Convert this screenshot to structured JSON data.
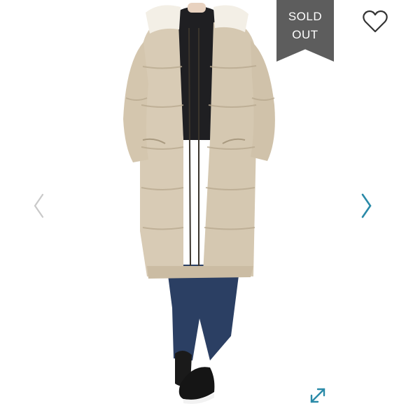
{
  "badge": {
    "line1": "SOLD",
    "line2": "OUT",
    "color": "#5d5d5d"
  },
  "icons": {
    "favorite": "heart-outline-icon",
    "previous": "chevron-left-icon",
    "next": "chevron-right-icon",
    "expand": "expand-arrows-icon"
  },
  "colors": {
    "accent": "#2a8aa8",
    "arrow_disabled": "#c9c9c9",
    "coat": "#d8cbb5",
    "jeans": "#2b3f63"
  }
}
